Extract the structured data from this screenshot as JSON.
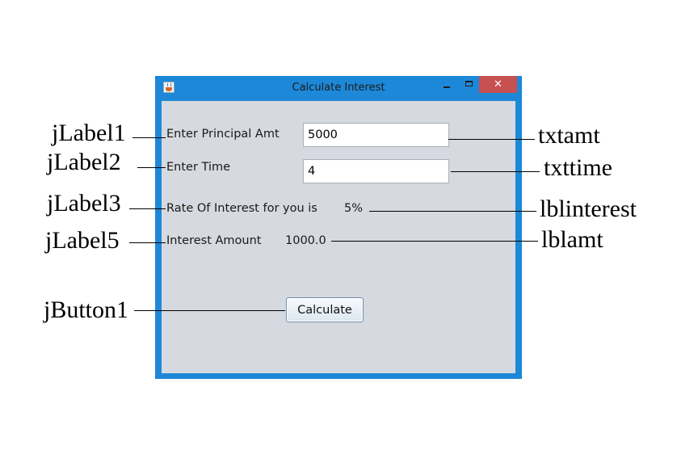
{
  "window": {
    "title": "Calculate Interest",
    "close_glyph": "✕",
    "icons": [
      "java-cup-icon",
      "minimize-icon",
      "maximize-icon",
      "close-icon"
    ]
  },
  "form": {
    "principal_label": "Enter Principal Amt",
    "principal_value": "5000",
    "time_label": "Enter Time",
    "time_value": "4",
    "rate_label": "Rate Of Interest for you is",
    "rate_value": "5%",
    "amount_label": "Interest Amount",
    "amount_value": "1000.0",
    "calculate_label": "Calculate"
  },
  "annotations": {
    "label1": "jLabel1",
    "label2": "jLabel2",
    "label3": "jLabel3",
    "label5": "jLabel5",
    "button1": "jButton1",
    "txtamt": "txtamt",
    "txttime": "txttime",
    "lblinterest": "lblinterest",
    "lblamt": "lblamt"
  },
  "colors": {
    "window_frame": "#1e88d8",
    "client_area": "#d6d9df",
    "close_button": "#c75050"
  }
}
